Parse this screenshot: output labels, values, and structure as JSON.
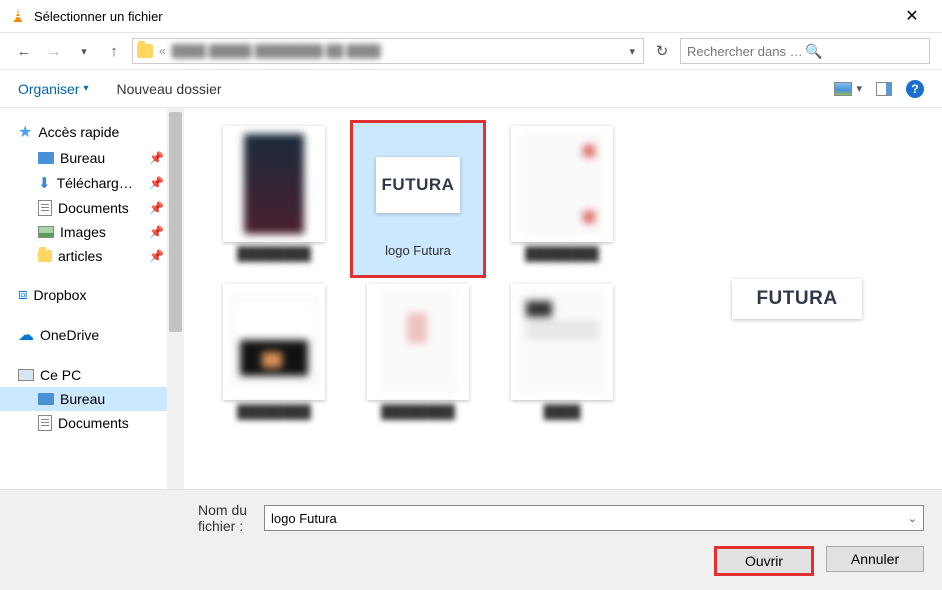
{
  "window": {
    "title": "Sélectionner un fichier"
  },
  "search": {
    "placeholder": "Rechercher dans : Comment in..."
  },
  "toolbar": {
    "organize": "Organiser",
    "newFolder": "Nouveau dossier"
  },
  "sidebar": {
    "quickAccess": "Accès rapide",
    "items": [
      {
        "label": "Bureau"
      },
      {
        "label": "Téléchargements"
      },
      {
        "label": "Documents"
      },
      {
        "label": "Images"
      },
      {
        "label": "articles"
      }
    ],
    "dropbox": "Dropbox",
    "onedrive": "OneDrive",
    "thisPC": "Ce PC",
    "pcChildren": [
      {
        "label": "Bureau"
      },
      {
        "label": "Documents"
      }
    ]
  },
  "files": {
    "selected": {
      "label": "logo Futura",
      "brand": "FUTURA"
    }
  },
  "preview": {
    "brand": "FUTURA"
  },
  "footer": {
    "filenameLabel": "Nom du fichier :",
    "filenameValue": "logo Futura",
    "open": "Ouvrir",
    "cancel": "Annuler"
  }
}
